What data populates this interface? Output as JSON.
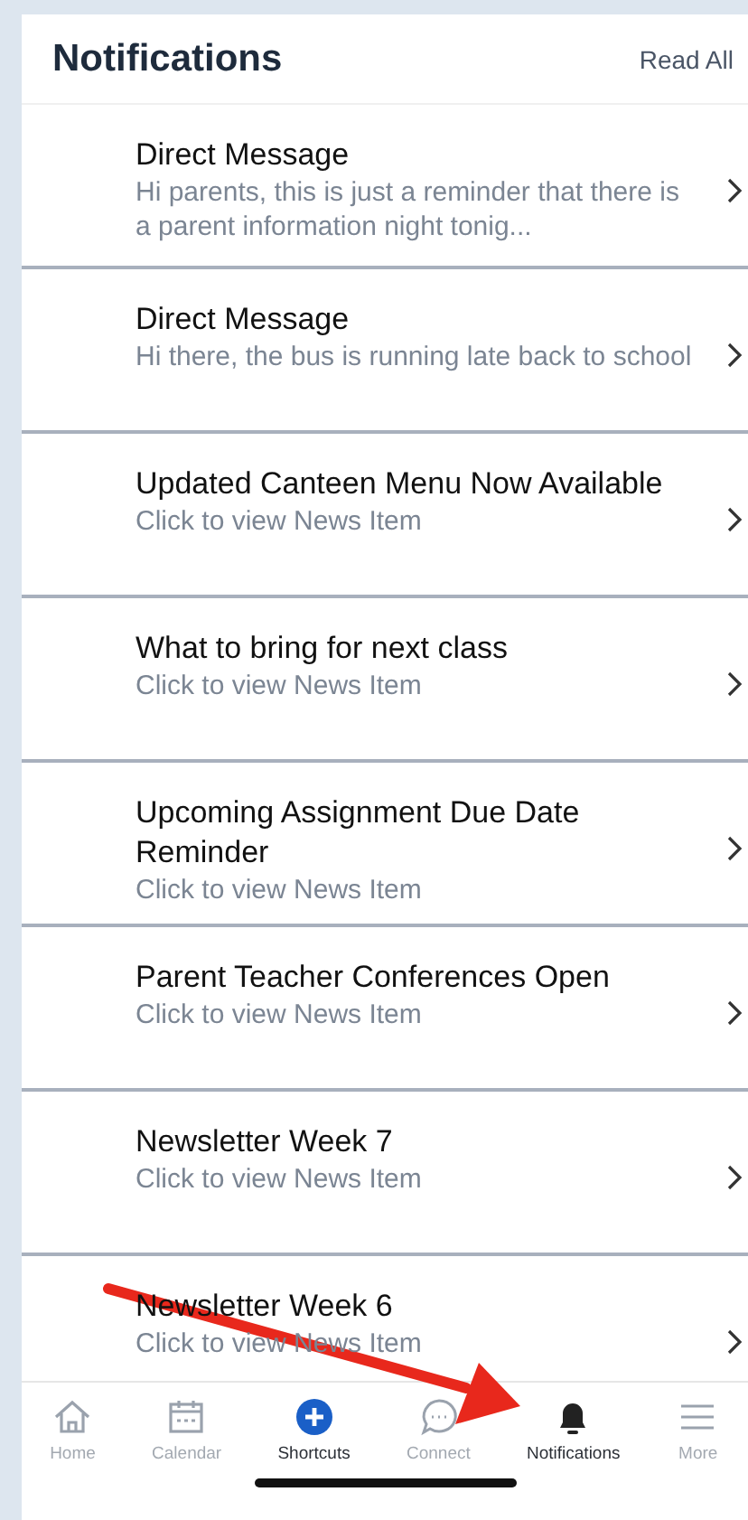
{
  "header": {
    "title": "Notifications",
    "action": "Read All"
  },
  "notifications": [
    {
      "title": "Direct Message",
      "subtitle": "Hi parents, this is just a reminder that there is a parent information night tonig..."
    },
    {
      "title": "Direct Message",
      "subtitle": "Hi there, the bus is running late back to school"
    },
    {
      "title": "Updated Canteen Menu Now Available",
      "subtitle": "Click to view News Item"
    },
    {
      "title": "What to bring for next class",
      "subtitle": "Click to view News Item"
    },
    {
      "title": "Upcoming Assignment Due Date Reminder",
      "subtitle": "Click to view News Item"
    },
    {
      "title": "Parent Teacher Conferences Open",
      "subtitle": "Click to view News Item"
    },
    {
      "title": "Newsletter Week 7",
      "subtitle": "Click to view News Item"
    },
    {
      "title": "Newsletter Week 6",
      "subtitle": "Click to view News Item"
    }
  ],
  "tab_bar": [
    {
      "kind": "home",
      "label": "Home",
      "selected": false
    },
    {
      "kind": "calendar",
      "label": "Calendar",
      "selected": false
    },
    {
      "kind": "plus",
      "label": "Shortcuts",
      "selected": true
    },
    {
      "kind": "chat",
      "label": "Connect",
      "selected": false
    },
    {
      "kind": "bell",
      "label": "Notifications",
      "selected": true
    },
    {
      "kind": "menu",
      "label": "More",
      "selected": false
    }
  ]
}
